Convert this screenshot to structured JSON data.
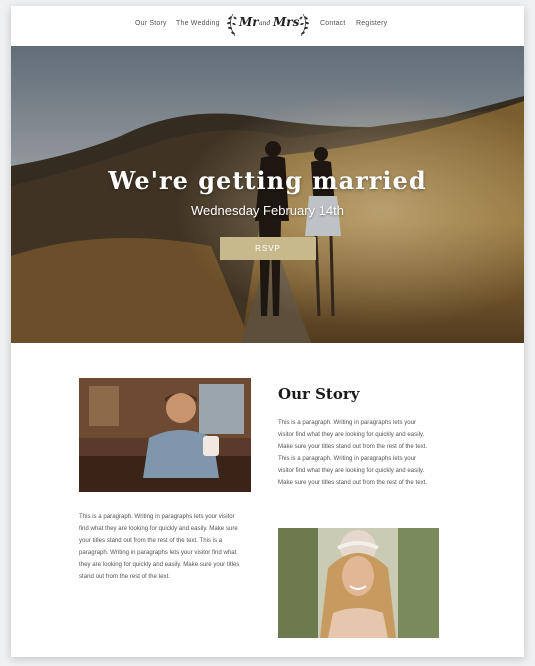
{
  "nav": {
    "links": [
      "Our Story",
      "The Wedding",
      "Contact",
      "Registery"
    ],
    "logo": {
      "left": "Mr",
      "middle": "and",
      "right": "Mrs"
    }
  },
  "hero": {
    "title": "We're getting married",
    "date": "Wednesday February 14th",
    "rsvp_label": "RSVP"
  },
  "story": {
    "title": "Our Story",
    "paragraph_right_lines": [
      "This is a paragraph. Writing in paragraphs lets your",
      "visitor find what they are looking for quickly and easily.",
      "Make sure your titles stand out from the rest of the text.",
      "This is a paragraph. Writing in paragraphs lets your",
      "visitor find what they are looking for quickly and easily.",
      "Make sure your titles stand out from the rest of the text."
    ],
    "paragraph_left_lines": [
      "This is a paragraph. Writing in paragraphs lets your visitor",
      "find what they are looking for quickly and easily. Make sure",
      "your titles stand out from the rest of the text. This is a",
      "paragraph. Writing in paragraphs lets your visitor find what",
      "they are looking for quickly and easily. Make sure your titles",
      "stand out from the rest of the text."
    ]
  },
  "colors": {
    "accent": "#c8b98d",
    "text": "#555555",
    "heading": "#1a1a1a"
  }
}
